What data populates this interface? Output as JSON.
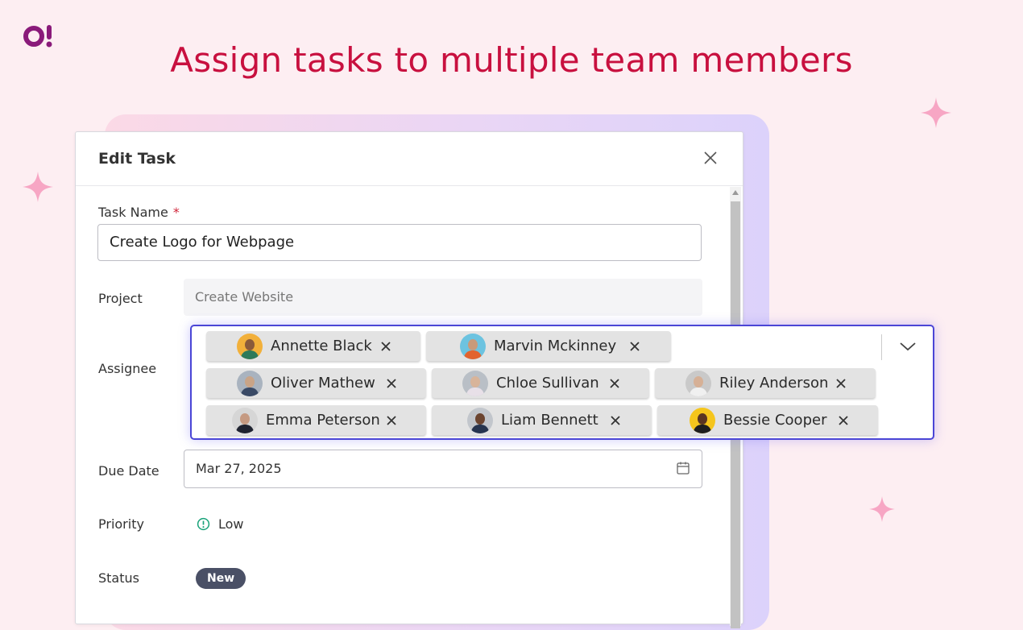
{
  "headline": "Assign tasks to multiple team members",
  "dialog": {
    "title": "Edit Task",
    "task_name_label": "Task Name",
    "required_marker": "*",
    "task_name_value": "Create Logo for Webpage",
    "project_label": "Project",
    "project_value": "Create Website",
    "assignee_label": "Assignee",
    "due_date_label": "Due Date",
    "due_date_value": "Mar 27, 2025",
    "priority_label": "Priority",
    "priority_value": "Low",
    "status_label": "Status",
    "status_value": "New"
  },
  "assignees": [
    {
      "name": "Annette Black",
      "avatar_bg": "#f2b03a"
    },
    {
      "name": "Marvin Mckinney",
      "avatar_bg": "#6cc3e0"
    },
    {
      "name": "Oliver Mathew",
      "avatar_bg": "#a9b3bf"
    },
    {
      "name": "Chloe Sullivan",
      "avatar_bg": "#b9bfc6"
    },
    {
      "name": "Riley Anderson",
      "avatar_bg": "#c9c9c9"
    },
    {
      "name": "Emma Peterson",
      "avatar_bg": "#d6d6d6"
    },
    {
      "name": "Liam Bennett",
      "avatar_bg": "#c2c6cc"
    },
    {
      "name": "Bessie Cooper",
      "avatar_bg": "#f5c51c"
    }
  ],
  "colors": {
    "brand": "#c8103f",
    "focus_border": "#4b46d6",
    "status_badge": "#4a5066",
    "priority_icon": "#1aa37a"
  }
}
